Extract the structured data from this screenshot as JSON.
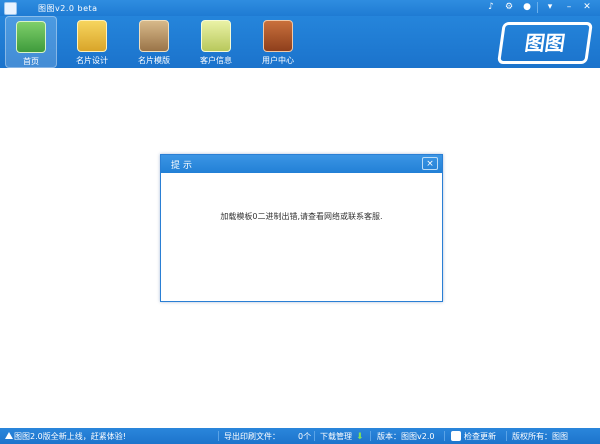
{
  "title_bar": {
    "app_title": "图图v2.0 beta",
    "controls": [
      "bell-icon",
      "gear-icon",
      "chat-icon",
      "menu-icon",
      "minimize-icon",
      "close-icon"
    ]
  },
  "toolbar": {
    "items": [
      {
        "label": "首页",
        "icon": "storefront-icon",
        "active": true
      },
      {
        "label": "名片设计",
        "icon": "pencil-card-icon",
        "active": false
      },
      {
        "label": "名片模版",
        "icon": "template-icon",
        "active": false
      },
      {
        "label": "客户信息",
        "icon": "clipboard-icon",
        "active": false
      },
      {
        "label": "用户中心",
        "icon": "user-book-icon",
        "active": false
      }
    ],
    "logo_text": "图图"
  },
  "dialog": {
    "title": "提示",
    "message": "加载模板0二进制出错,请查看网络或联系客服.",
    "close_label": "×"
  },
  "status_bar": {
    "announcement": "图图2.0版全新上线，赶紧体验!",
    "export_label": "导出印刷文件：",
    "export_count": "0个",
    "download_label": "下载管理",
    "version_label": "版本：图图v2.0",
    "check_update_label": "检查更新",
    "copyright_label": "版权所有：图图"
  },
  "colors": {
    "brand_blue": "#1f7bd3",
    "dialog_border": "#2a7fd4",
    "download_arrow": "#7fe05a"
  }
}
